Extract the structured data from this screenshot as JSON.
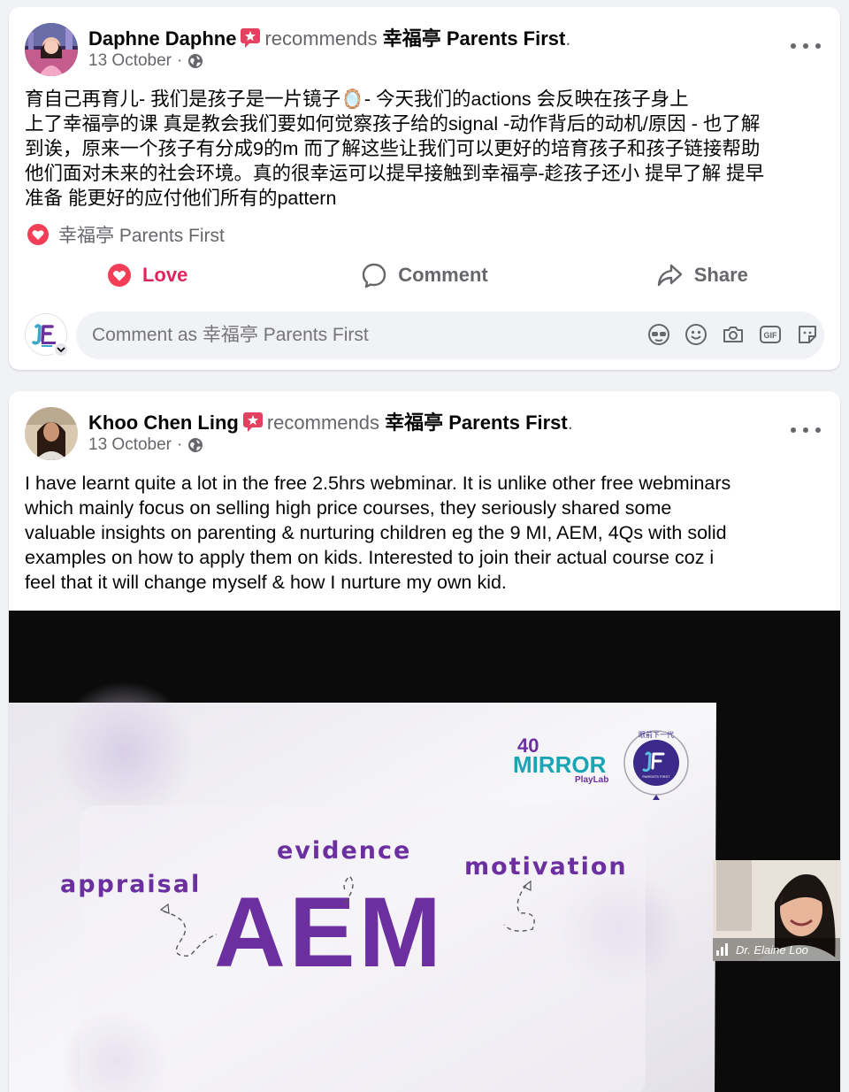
{
  "posts": [
    {
      "author": "Daphne Daphne",
      "verb": "recommends",
      "page": "幸福亭 Parents First",
      "date": "13 October",
      "separator": "·",
      "text_lines": [
        "育自己再育儿- 我们是孩子是一片镜子🪞- 今天我们的actions 会反映在孩子身上",
        "上了幸福亭的课 真是教会我们要如何觉察孩子给的signal -动作背后的动机/原因 - 也了解",
        "到诶，原来一个孩子有分成9的m 而了解这些让我们可以更好的培育孩子和孩子链接帮助",
        "他们面对未来的社会环境。真的很幸运可以提早接触到幸福亭-趁孩子还小 提早了解 提早",
        "准备 能更好的应付他们所有的pattern"
      ],
      "reaction_label": "幸福亭 Parents First",
      "actions": {
        "love": "Love",
        "comment": "Comment",
        "share": "Share"
      },
      "comment_placeholder": "Comment as 幸福亭 Parents First"
    },
    {
      "author": "Khoo Chen Ling",
      "verb": "recommends",
      "page": "幸福亭 Parents First",
      "date": "13 October",
      "separator": "·",
      "text_lines": [
        "I have learnt quite a lot in the free 2.5hrs webminar. It is unlike other free webminars",
        "which mainly focus on selling high price courses, they seriously shared some",
        "valuable insights on parenting & nurturing children eg the 9 MI, AEM, 4Qs with solid",
        "examples on how to apply them on kids. Interested to join their actual course coz i",
        "feel that it will change myself & how I nurture my own kid."
      ],
      "image": {
        "slide": {
          "big_word": "AEM",
          "word_left": "appraisal",
          "word_mid": "evidence",
          "word_right": "motivation",
          "logo_number": "40",
          "logo_text": "MIRROR",
          "logo_sub": "PlayLab",
          "pf_ring_text": "眼前下一代",
          "pf_text": "PARENTS FIRST"
        },
        "video_name": "Dr. Elaine Loo"
      }
    }
  ],
  "colors": {
    "love": "#e0245e",
    "secondary_text": "#65676b",
    "badge": "#e4405f",
    "slide_purple": "#6b2fa0",
    "logo_teal": "#1aa5b5"
  }
}
